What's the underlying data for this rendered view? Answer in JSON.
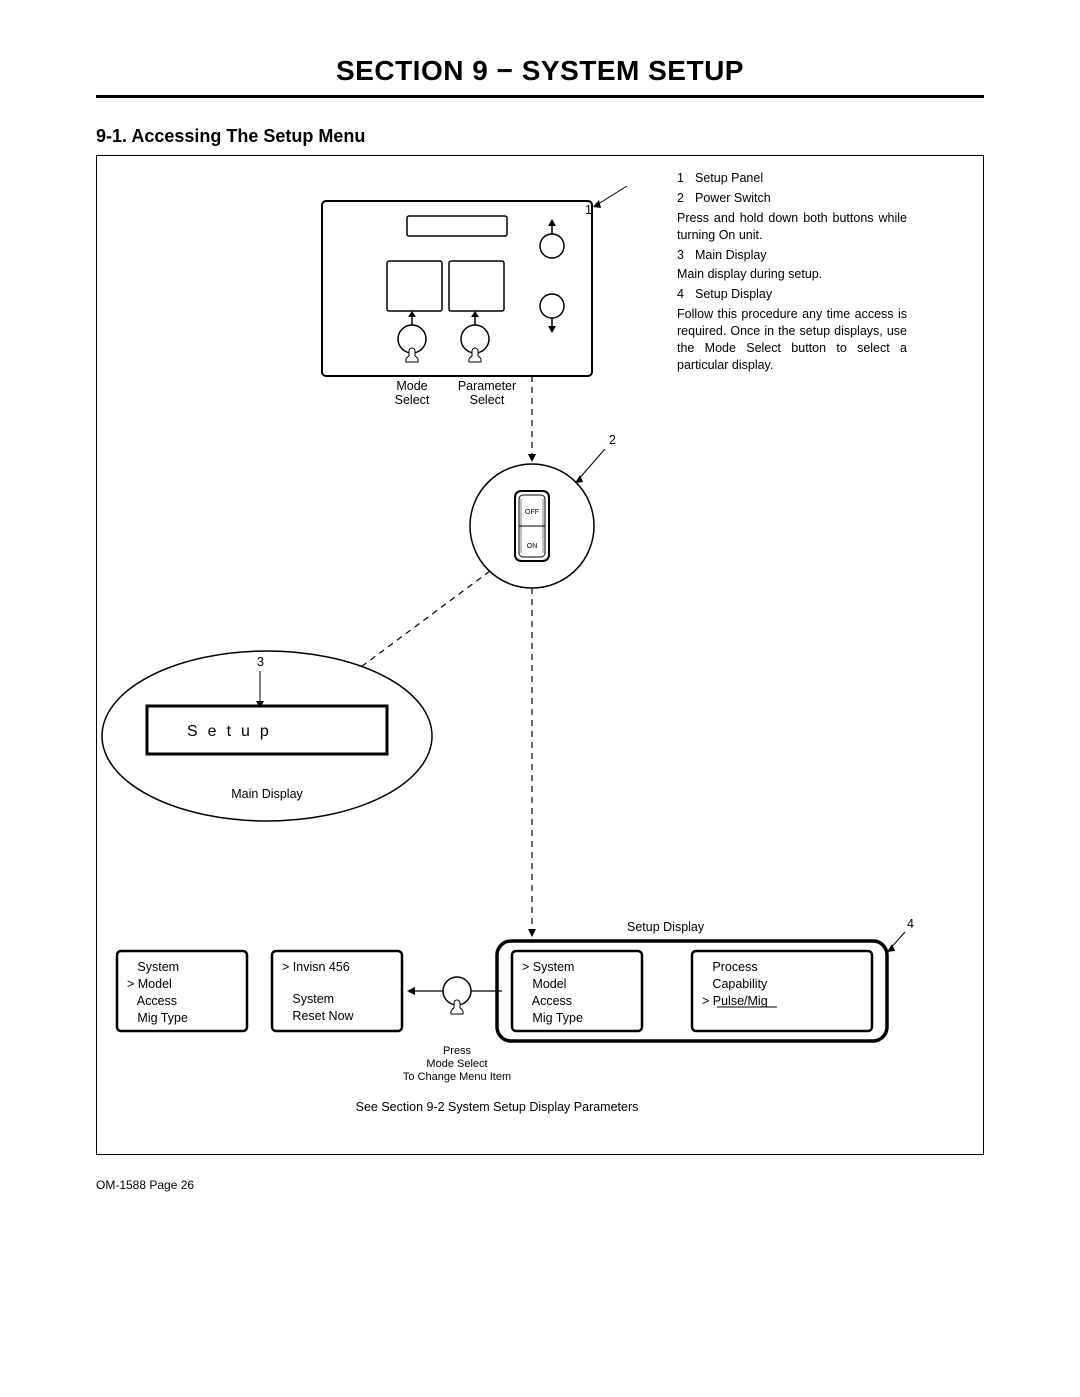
{
  "header": {
    "section_title": "SECTION 9 − SYSTEM SETUP",
    "subsection": "9-1.  Accessing The Setup Menu"
  },
  "legend": {
    "item1_num": "1",
    "item1_label": "Setup Panel",
    "item2_num": "2",
    "item2_label": "Power Switch",
    "note2": "Press and hold down both buttons while turning On unit.",
    "item3_num": "3",
    "item3_label": "Main Display",
    "note3": "Main display during setup.",
    "item4_num": "4",
    "item4_label": "Setup Display",
    "note4": "Follow this procedure any time access is required. Once in the setup displays, use the Mode Select button to select a particular display."
  },
  "panel": {
    "mode_select_l1": "Mode",
    "mode_select_l2": "Select",
    "param_select_l1": "Parameter",
    "param_select_l2": "Select",
    "callout1": "1"
  },
  "power": {
    "callout2": "2",
    "off": "OFF",
    "on": "ON"
  },
  "main_display": {
    "callout3": "3",
    "text": "Setup",
    "label": "Main Display"
  },
  "setup_display": {
    "label": "Setup Display",
    "callout4": "4",
    "box1_l1": "   System",
    "box1_l2": "> Model",
    "box1_l3": "   Access",
    "box1_l4": "   Mig Type",
    "box2_l1": "> Invisn 456",
    "box2_l2": "   System",
    "box2_l3": "   Reset Now",
    "box3_l1": "> System",
    "box3_l2": "   Model",
    "box3_l3": "   Access",
    "box3_l4": "   Mig Type",
    "box4_l1": "   Process",
    "box4_l2": "   Capability",
    "box4_l3": "> Pulse/Mig",
    "press_l1": "Press",
    "press_l2": "Mode Select",
    "press_l3": "To Change Menu Item",
    "footnote": "See Section 9-2 System Setup Display Parameters"
  },
  "footer": "OM-1588 Page 26"
}
